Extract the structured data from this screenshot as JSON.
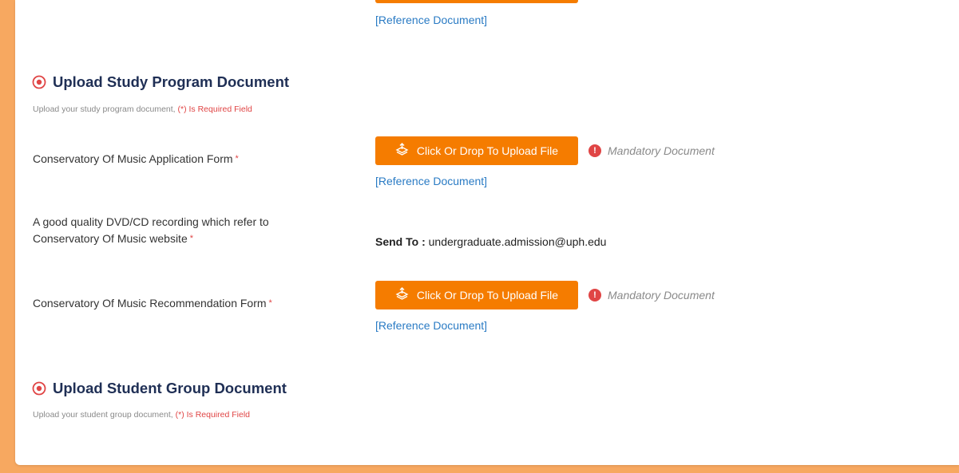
{
  "top": {
    "reference_link": "[Reference Document]"
  },
  "study_program": {
    "title": "Upload Study Program Document",
    "subtitle": "Upload your study program document,",
    "required_note": "(*) Is Required Field",
    "fields": [
      {
        "label": "Conservatory Of Music Application Form",
        "required_mark": "*",
        "button_label": "Click Or Drop To Upload File",
        "mandatory_text": "Mandatory Document",
        "reference_link": "[Reference Document]"
      },
      {
        "label_line1": "A good quality DVD/CD recording which refer to",
        "label_line2": "Conservatory Of Music website",
        "required_mark": "*",
        "send_to_label": "Send To :",
        "send_to_email": "undergraduate.admission@uph.edu"
      },
      {
        "label": "Conservatory Of Music Recommendation Form",
        "required_mark": "*",
        "button_label": "Click Or Drop To Upload File",
        "mandatory_text": "Mandatory Document",
        "reference_link": "[Reference Document]"
      }
    ]
  },
  "student_group": {
    "title": "Upload Student Group Document",
    "subtitle": "Upload your student group document,",
    "required_note": "(*) Is Required Field"
  },
  "icons": {
    "section": "target-circle-icon",
    "upload": "upload-tray-icon",
    "alert": "exclamation-circle-icon"
  },
  "colors": {
    "accent": "#f57c00",
    "background": "#f7a860",
    "link": "#2a7bc4",
    "required": "#e04545",
    "title": "#1f2f55"
  }
}
